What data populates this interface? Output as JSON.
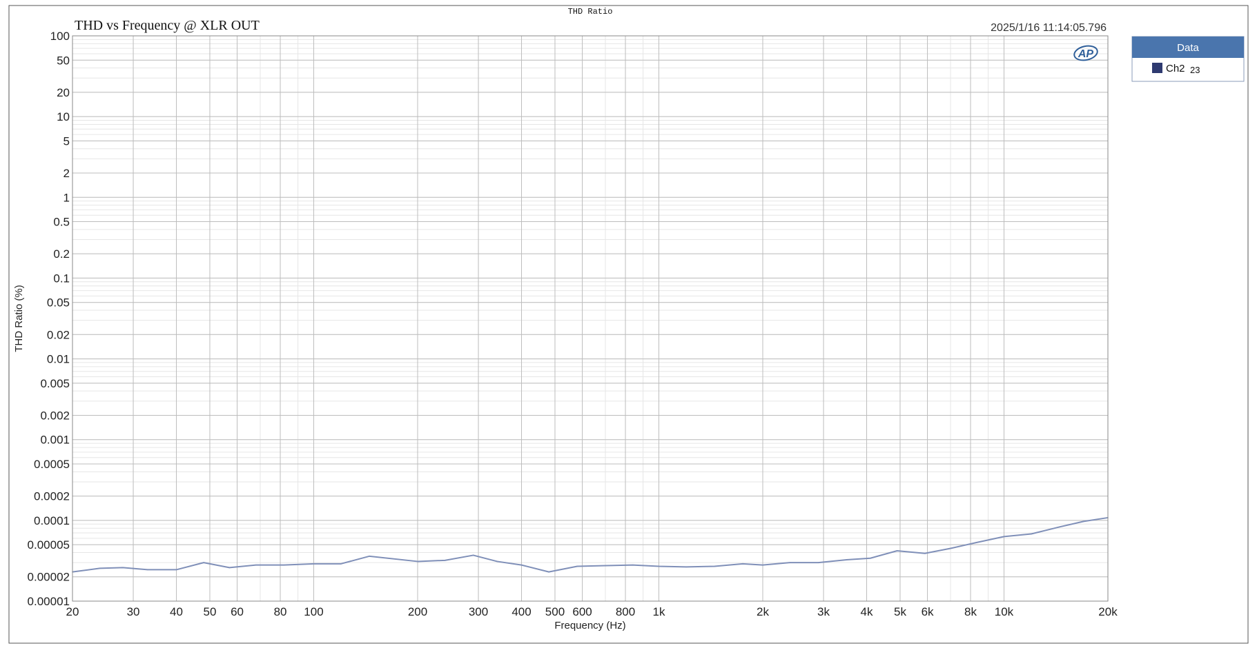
{
  "window": {
    "title": "THD Ratio"
  },
  "header": {
    "timestamp": "2025/1/16 11:14:05.796",
    "logo_text": "AP"
  },
  "legend": {
    "header": "Data",
    "items": [
      {
        "label": "Ch2",
        "sublabel": "23",
        "color": "#2e3a70"
      }
    ]
  },
  "chart_data": {
    "type": "line",
    "title": "THD vs Frequency @ XLR OUT",
    "xlabel": "Frequency (Hz)",
    "ylabel": "THD Ratio (%)",
    "x_scale": "log",
    "y_scale": "log",
    "xlim": [
      20,
      20000
    ],
    "ylim": [
      1e-05,
      100
    ],
    "grid": true,
    "legend_position": "right",
    "x_ticks": [
      {
        "value": 20,
        "label": "20"
      },
      {
        "value": 30,
        "label": "30"
      },
      {
        "value": 40,
        "label": "40"
      },
      {
        "value": 50,
        "label": "50"
      },
      {
        "value": 60,
        "label": "60"
      },
      {
        "value": 80,
        "label": "80"
      },
      {
        "value": 100,
        "label": "100"
      },
      {
        "value": 200,
        "label": "200"
      },
      {
        "value": 300,
        "label": "300"
      },
      {
        "value": 400,
        "label": "400"
      },
      {
        "value": 500,
        "label": "500"
      },
      {
        "value": 600,
        "label": "600"
      },
      {
        "value": 800,
        "label": "800"
      },
      {
        "value": 1000,
        "label": "1k"
      },
      {
        "value": 2000,
        "label": "2k"
      },
      {
        "value": 3000,
        "label": "3k"
      },
      {
        "value": 4000,
        "label": "4k"
      },
      {
        "value": 5000,
        "label": "5k"
      },
      {
        "value": 6000,
        "label": "6k"
      },
      {
        "value": 8000,
        "label": "8k"
      },
      {
        "value": 10000,
        "label": "10k"
      },
      {
        "value": 20000,
        "label": "20k"
      }
    ],
    "y_ticks": [
      {
        "value": 100,
        "label": "100"
      },
      {
        "value": 50,
        "label": "50"
      },
      {
        "value": 20,
        "label": "20"
      },
      {
        "value": 10,
        "label": "10"
      },
      {
        "value": 5,
        "label": "5"
      },
      {
        "value": 2,
        "label": "2"
      },
      {
        "value": 1,
        "label": "1"
      },
      {
        "value": 0.5,
        "label": "0.5"
      },
      {
        "value": 0.2,
        "label": "0.2"
      },
      {
        "value": 0.1,
        "label": "0.1"
      },
      {
        "value": 0.05,
        "label": "0.05"
      },
      {
        "value": 0.02,
        "label": "0.02"
      },
      {
        "value": 0.01,
        "label": "0.01"
      },
      {
        "value": 0.005,
        "label": "0.005"
      },
      {
        "value": 0.002,
        "label": "0.002"
      },
      {
        "value": 0.001,
        "label": "0.001"
      },
      {
        "value": 0.0005,
        "label": "0.0005"
      },
      {
        "value": 0.0002,
        "label": "0.0002"
      },
      {
        "value": 0.0001,
        "label": "0.0001"
      },
      {
        "value": 5e-05,
        "label": "0.00005"
      },
      {
        "value": 2e-05,
        "label": "0.00002"
      },
      {
        "value": 1e-05,
        "label": "0.00001"
      }
    ],
    "series": [
      {
        "name": "Ch2",
        "color": "#7f8fb8",
        "points": [
          [
            20,
            2.3e-05
          ],
          [
            24,
            2.55e-05
          ],
          [
            28,
            2.6e-05
          ],
          [
            33,
            2.45e-05
          ],
          [
            40,
            2.45e-05
          ],
          [
            48,
            3e-05
          ],
          [
            57,
            2.6e-05
          ],
          [
            68,
            2.8e-05
          ],
          [
            82,
            2.8e-05
          ],
          [
            100,
            2.9e-05
          ],
          [
            120,
            2.9e-05
          ],
          [
            145,
            3.6e-05
          ],
          [
            200,
            3.1e-05
          ],
          [
            240,
            3.2e-05
          ],
          [
            290,
            3.7e-05
          ],
          [
            340,
            3.1e-05
          ],
          [
            400,
            2.8e-05
          ],
          [
            480,
            2.3e-05
          ],
          [
            580,
            2.7e-05
          ],
          [
            700,
            2.75e-05
          ],
          [
            840,
            2.8e-05
          ],
          [
            1000,
            2.7e-05
          ],
          [
            1200,
            2.65e-05
          ],
          [
            1450,
            2.7e-05
          ],
          [
            1750,
            2.9e-05
          ],
          [
            2000,
            2.8e-05
          ],
          [
            2400,
            3e-05
          ],
          [
            2900,
            3e-05
          ],
          [
            3500,
            3.25e-05
          ],
          [
            4100,
            3.4e-05
          ],
          [
            4900,
            4.2e-05
          ],
          [
            5900,
            3.9e-05
          ],
          [
            7000,
            4.5e-05
          ],
          [
            8300,
            5.3e-05
          ],
          [
            10000,
            6.3e-05
          ],
          [
            12000,
            6.8e-05
          ],
          [
            14500,
            8.3e-05
          ],
          [
            17000,
            9.7e-05
          ],
          [
            20000,
            0.000108
          ]
        ]
      }
    ]
  }
}
